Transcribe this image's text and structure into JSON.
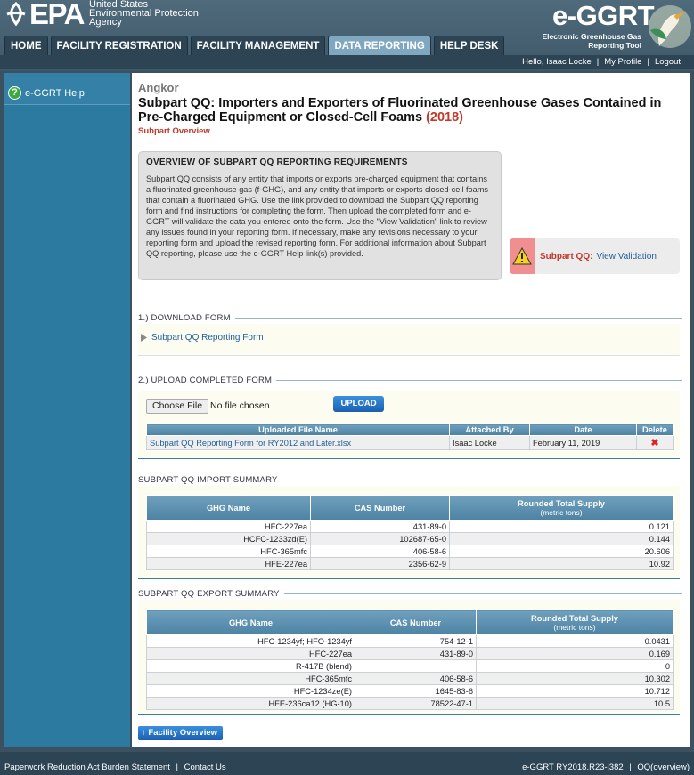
{
  "header": {
    "epa_word": "EPA",
    "agency_lines": [
      "United States",
      "Environmental Protection",
      "Agency"
    ],
    "app_title": "e-GGRT",
    "app_subtitle_lines": [
      "Electronic Greenhouse Gas",
      "Reporting Tool"
    ]
  },
  "nav": {
    "tabs": [
      {
        "label": "HOME"
      },
      {
        "label": "FACILITY REGISTRATION"
      },
      {
        "label": "FACILITY MANAGEMENT"
      },
      {
        "label": "DATA REPORTING"
      },
      {
        "label": "HELP DESK"
      }
    ],
    "active": "DATA REPORTING"
  },
  "userbar": {
    "greeting": "Hello, Isaac Locke",
    "profile": "My Profile",
    "logout": "Logout",
    "sep": "|"
  },
  "sidebar": {
    "help_label": "e-GGRT Help",
    "help_icon": "question-icon"
  },
  "page": {
    "facility": "Angkor",
    "title": "Subpart QQ: Importers and Exporters of Fluorinated Greenhouse Gases Contained in Pre-Charged Equipment or Closed-Cell Foams",
    "year": "(2018)",
    "subtitle": "Subpart Overview"
  },
  "overview": {
    "heading": "OVERVIEW OF SUBPART QQ REPORTING REQUIREMENTS",
    "text": "Subpart QQ consists of any entity that imports or exports pre-charged equipment that contains a fluorinated greenhouse gas (f-GHG), and any entity that imports or exports closed-cell foams that contain a fluorinated GHG. Use the link provided to download the Subpart QQ reporting form and find instructions for completing the form. Then upload the completed form and e-GGRT will validate the data you entered onto the form. Use the \"View Validation\" link to review any issues found in your reporting form. If necessary, make any revisions necessary to your reporting form and upload the revised reporting form. For additional information about Subpart QQ reporting, please use the e-GGRT Help link(s) provided."
  },
  "validation": {
    "label": "Subpart QQ:",
    "link": "View Validation",
    "icon": "warning-icon"
  },
  "download": {
    "heading": "1.) DOWNLOAD FORM",
    "link": "Subpart QQ Reporting Form"
  },
  "upload": {
    "heading": "2.) UPLOAD COMPLETED FORM",
    "choose_label": "Choose File",
    "no_file": "No file chosen",
    "upload_label": "UPLOAD",
    "table": {
      "headers": [
        "Uploaded File Name",
        "Attached By",
        "Date",
        "Delete"
      ],
      "rows": [
        {
          "file": "Subpart QQ Reporting Form for RY2012 and Later.xlsx",
          "by": "Isaac Locke",
          "date": "February 11, 2019",
          "delete": "✖"
        }
      ]
    }
  },
  "import_summary": {
    "heading": "SUBPART QQ IMPORT SUMMARY",
    "headers": [
      "GHG Name",
      "CAS Number",
      "Rounded Total Supply"
    ],
    "unit": "(metric tons)",
    "rows": [
      [
        "HFC-227ea",
        "431-89-0",
        "0.121"
      ],
      [
        "HCFC-1233zd(E)",
        "102687-65-0",
        "0.144"
      ],
      [
        "HFC-365mfc",
        "406-58-6",
        "20.606"
      ],
      [
        "HFE-227ea",
        "2356-62-9",
        "10.92"
      ]
    ]
  },
  "export_summary": {
    "heading": "SUBPART QQ EXPORT SUMMARY",
    "headers": [
      "GHG Name",
      "CAS Number",
      "Rounded Total Supply"
    ],
    "unit": "(metric tons)",
    "rows": [
      [
        "HFC-1234yf; HFO-1234yf",
        "754-12-1",
        "0.0431"
      ],
      [
        "HFC-227ea",
        "431-89-0",
        "0.169"
      ],
      [
        "R-417B (blend)",
        "",
        "0"
      ],
      [
        "HFC-365mfc",
        "406-58-6",
        "10.302"
      ],
      [
        "HFC-1234ze(E)",
        "1645-83-6",
        "10.712"
      ],
      [
        "HFE-236ca12 (HG-10)",
        "78522-47-1",
        "10.5"
      ]
    ]
  },
  "facility_overview_button": "Facility Overview",
  "footer": {
    "paperwork": "Paperwork Reduction Act Burden Statement",
    "contact": "Contact Us",
    "version": "e-GGRT RY2018.R23-j382",
    "page": "QQ(overview)",
    "sep": "|"
  },
  "colors": {
    "accent": "#2c7aa0",
    "year_red": "#c0392b",
    "link": "#1f5f9a"
  }
}
